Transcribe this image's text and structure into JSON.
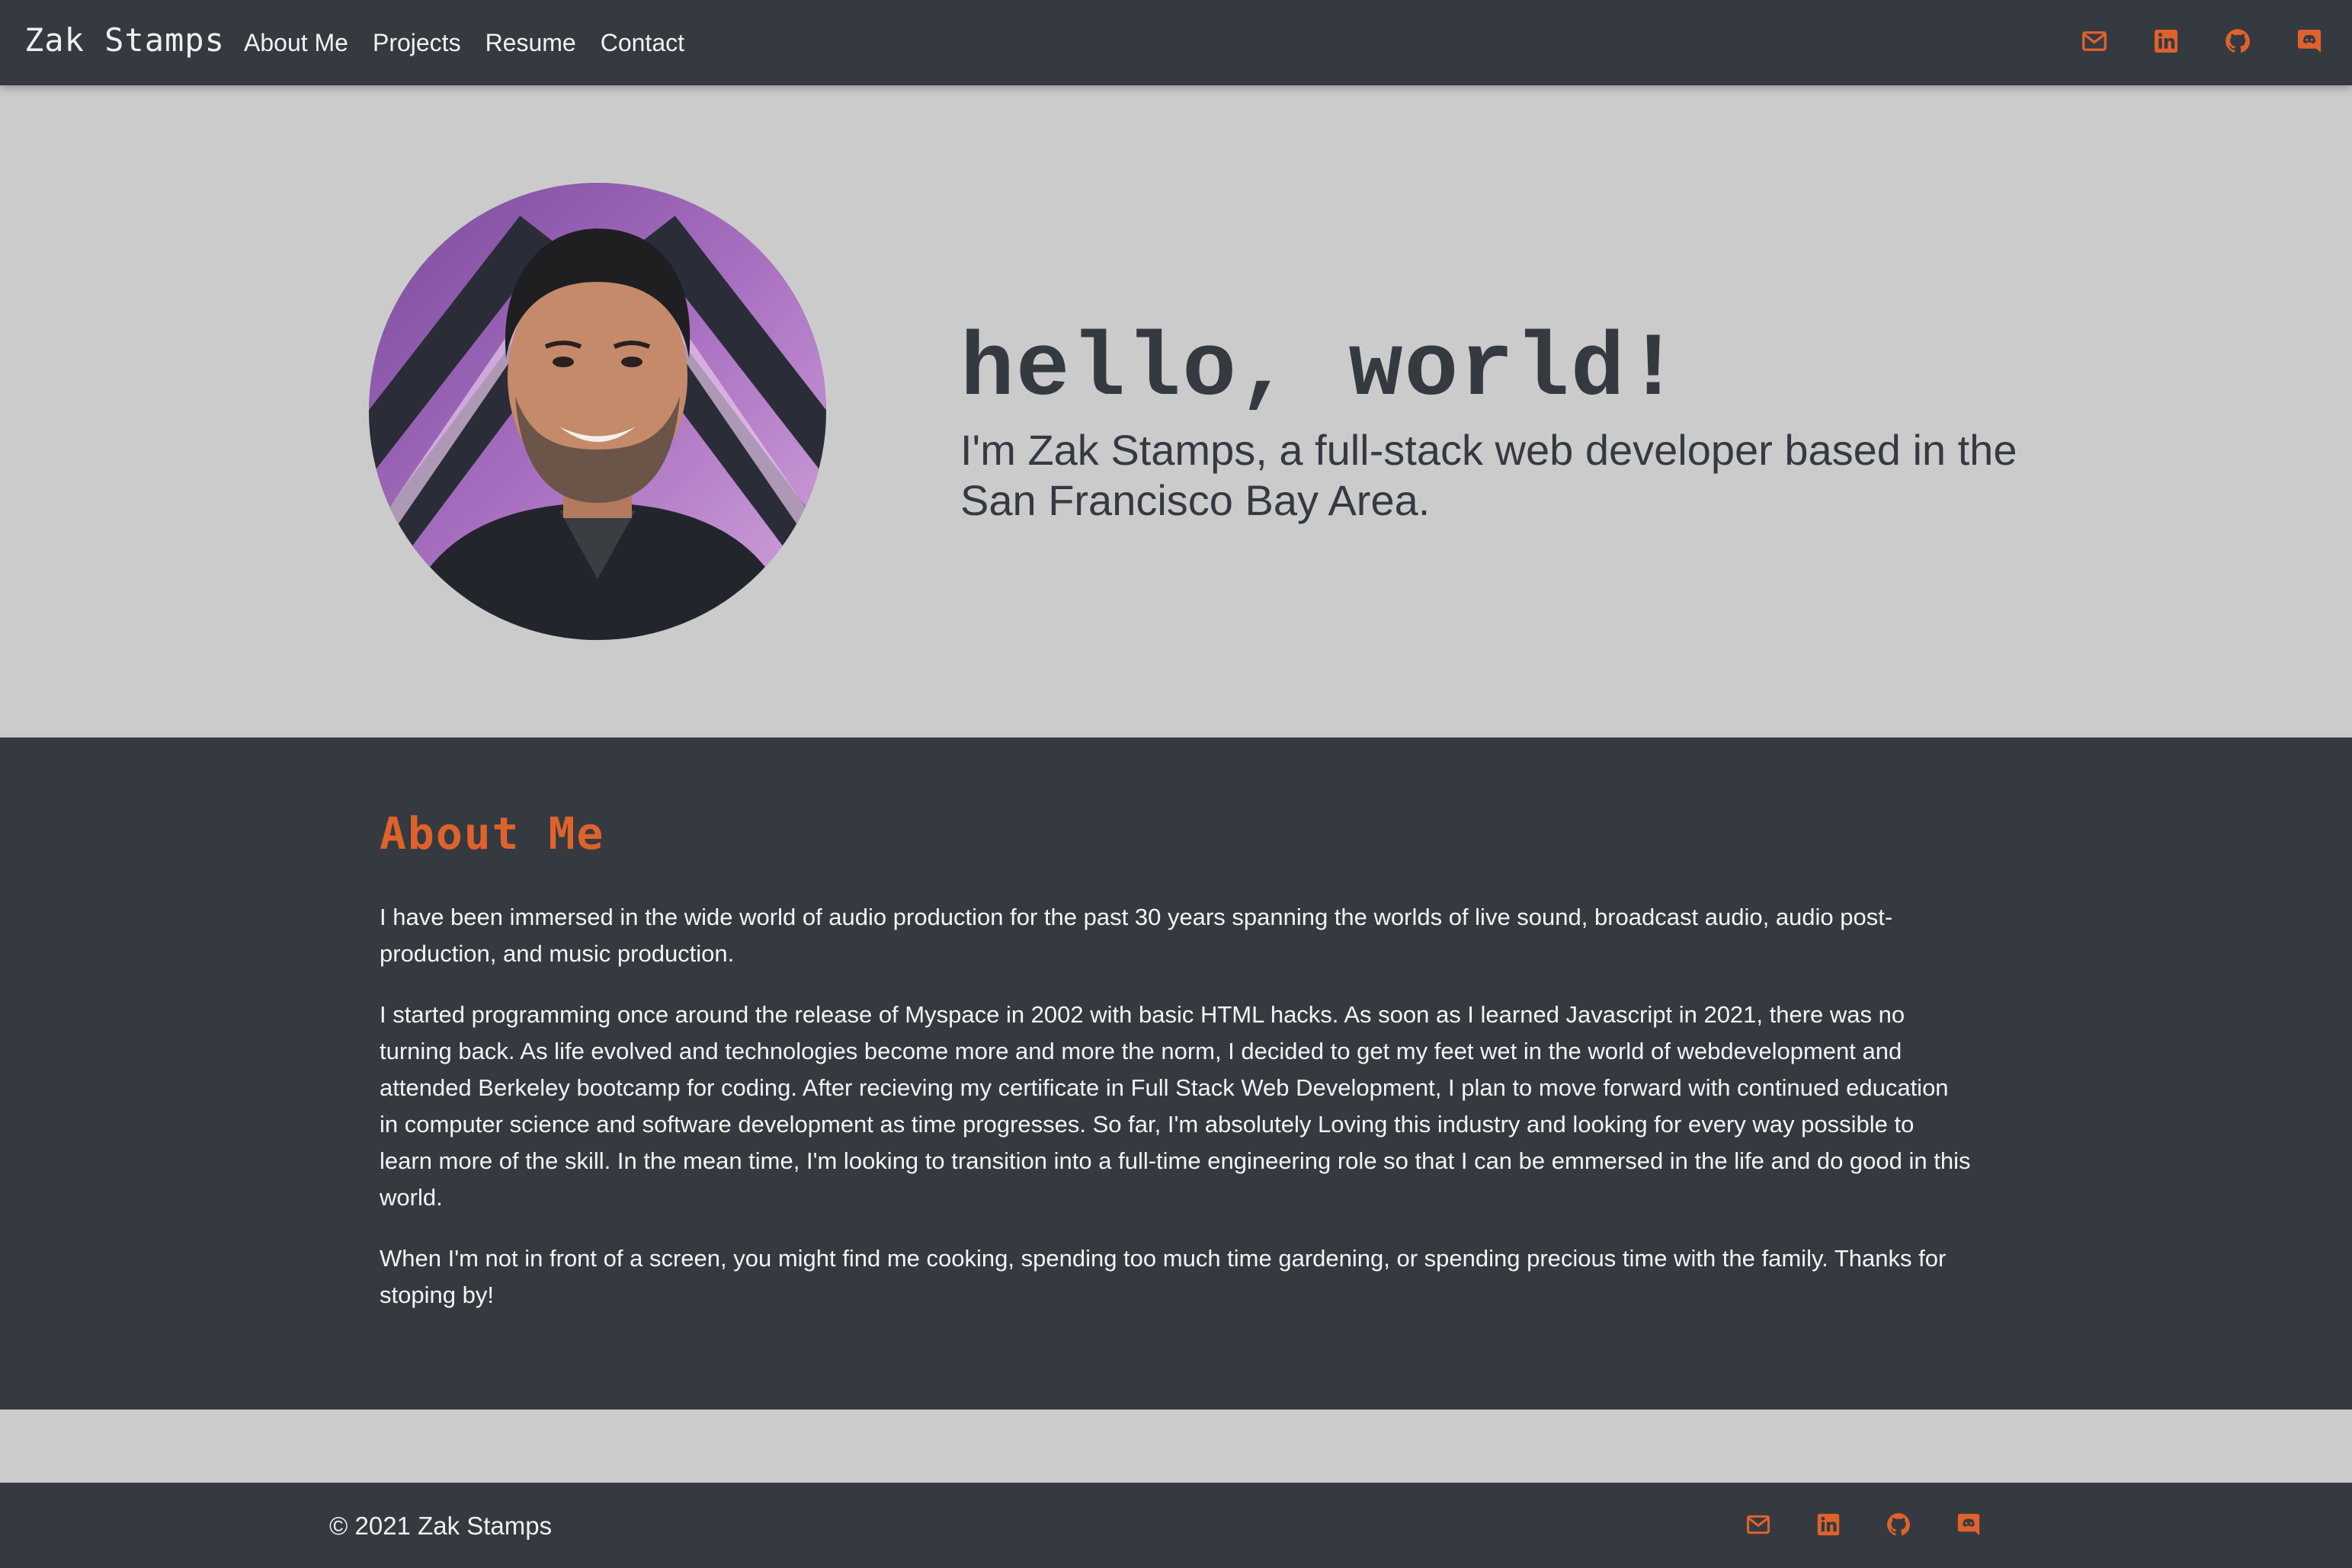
{
  "nav": {
    "brand": "Zak Stamps",
    "links": [
      "About Me",
      "Projects",
      "Resume",
      "Contact"
    ],
    "icons": [
      "envelope-icon",
      "linkedin-icon",
      "github-icon",
      "discord-icon"
    ]
  },
  "hero": {
    "title": "hello, world!",
    "subtitle": "I'm Zak Stamps, a full-stack web developer based in the San Francisco Bay Area."
  },
  "about": {
    "title": "About Me",
    "paragraphs": [
      "I have been immersed in the wide world of audio production for the past 30 years spanning the worlds of live sound, broadcast audio, audio post-production, and music production.",
      "I started programming once around the release of Myspace in 2002 with basic HTML hacks. As soon as I learned Javascript in 2021, there was no turning back. As life evolved and technologies become more and more the norm, I decided to get my feet wet in the world of webdevelopment and attended Berkeley bootcamp for coding. After recieving my certificate in Full Stack Web Development, I plan to move forward with continued education in computer science and software development as time progresses. So far, I'm absolutely Loving this industry and looking for every way possible to learn more of the skill. In the mean time, I'm looking to transition into a full-time engineering role so that I can be emmersed in the life and do good in this world.",
      "When I'm not in front of a screen, you might find me cooking, spending too much time gardening, or spending precious time with the family. Thanks for stoping by!"
    ]
  },
  "footer": {
    "copyright": "© 2021 Zak Stamps",
    "icons": [
      "envelope-icon",
      "linkedin-icon",
      "github-icon",
      "discord-icon"
    ]
  },
  "colors": {
    "dark": "#353a41",
    "light_bg": "#cbcbcb",
    "accent": "#e0622b"
  }
}
